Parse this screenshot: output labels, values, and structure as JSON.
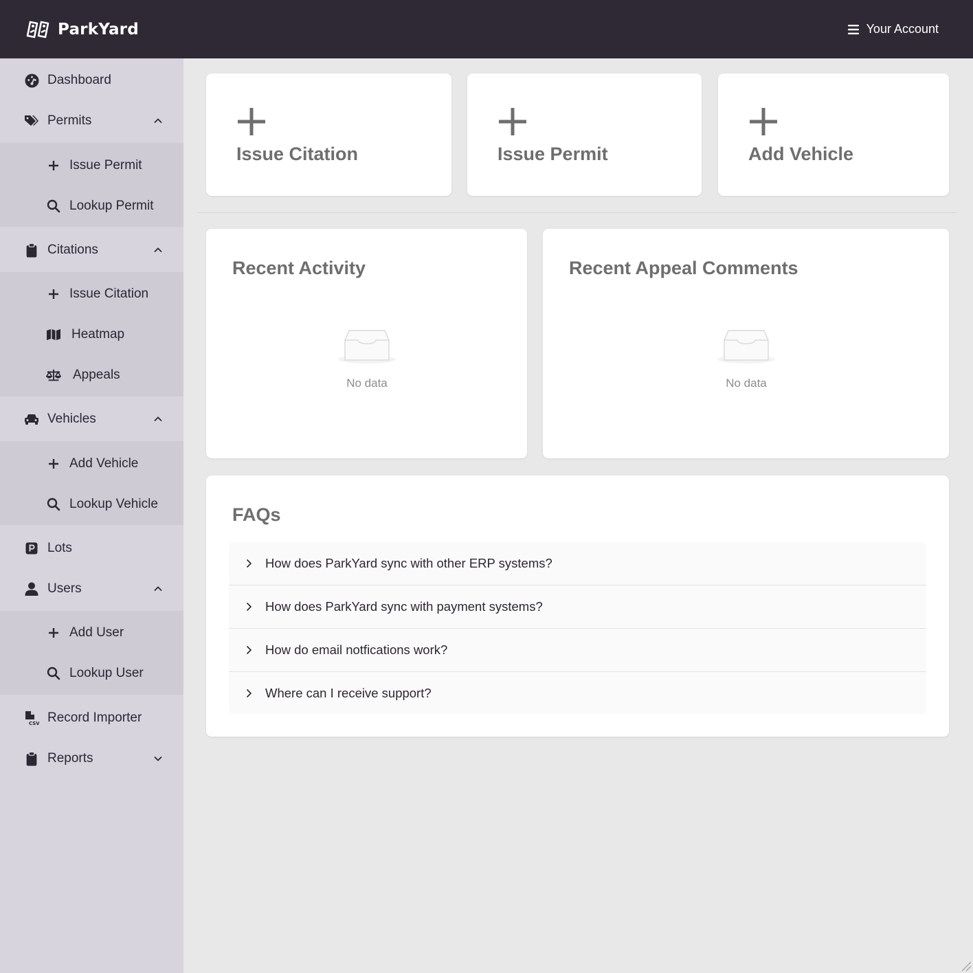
{
  "header": {
    "brand": "ParkYard",
    "account_label": "Your Account"
  },
  "sidebar": {
    "dashboard": "Dashboard",
    "permits": {
      "label": "Permits",
      "items": [
        "Issue Permit",
        "Lookup Permit"
      ]
    },
    "citations": {
      "label": "Citations",
      "items": [
        "Issue Citation",
        "Heatmap",
        "Appeals"
      ]
    },
    "vehicles": {
      "label": "Vehicles",
      "items": [
        "Add Vehicle",
        "Lookup Vehicle"
      ]
    },
    "lots": "Lots",
    "users": {
      "label": "Users",
      "items": [
        "Add User",
        "Lookup User"
      ]
    },
    "record_importer": "Record Importer",
    "reports": "Reports"
  },
  "quick_actions": [
    "Issue Citation",
    "Issue Permit",
    "Add Vehicle"
  ],
  "recent_activity": {
    "title": "Recent Activity",
    "empty_text": "No data"
  },
  "recent_appeal_comments": {
    "title": "Recent Appeal Comments",
    "empty_text": "No data"
  },
  "faqs": {
    "title": "FAQs",
    "items": [
      "How does ParkYard sync with other ERP systems?",
      "How does ParkYard sync with payment systems?",
      "How do email notfications work?",
      "Where can I receive support?"
    ]
  },
  "colors": {
    "topbar": "#2e2935",
    "sidebar": "#d8d4de",
    "sidebar_sub": "#cfcbd4",
    "content_bg": "#e9e8e9",
    "card_title": "#6e6e6e"
  },
  "icons": {
    "brand": "parking-tags-icon",
    "account": "menu-icon",
    "dashboard": "gauge-icon",
    "permits": "tags-icon",
    "citations": "clipboard-icon",
    "vehicles": "car-icon",
    "lots": "parking-sign-icon",
    "users": "user-icon",
    "record_importer": "csv-file-icon",
    "reports": "clipboard-icon"
  }
}
